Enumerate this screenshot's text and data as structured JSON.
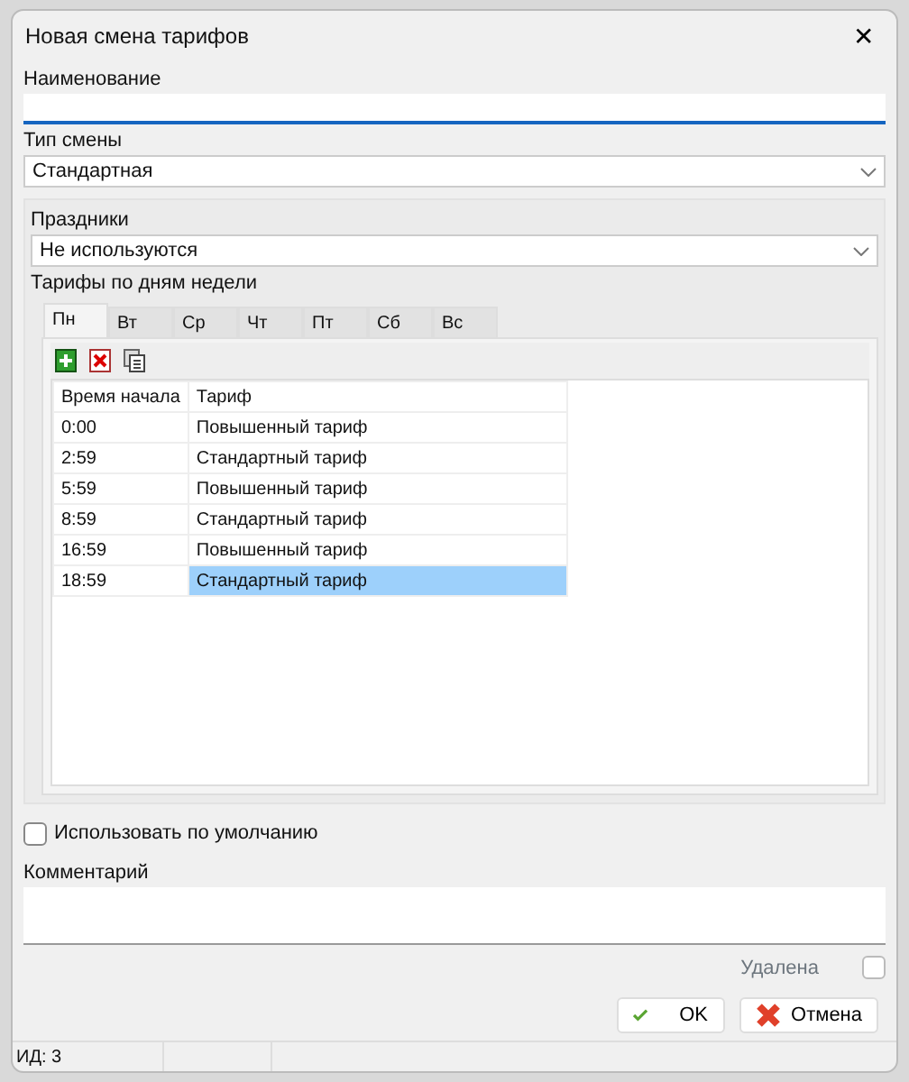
{
  "window": {
    "title": "Новая смена тарифов",
    "close": "✕"
  },
  "name_field": {
    "label": "Наименование"
  },
  "shift_type": {
    "label": "Тип смены",
    "value": "Стандартная"
  },
  "holidays": {
    "label": "Праздники",
    "value": "Не используются"
  },
  "tariffs": {
    "label": "Тарифы по дням недели",
    "tabs": [
      {
        "label": "Пн",
        "selected": true
      },
      {
        "label": "Вт",
        "selected": false
      },
      {
        "label": "Ср",
        "selected": false
      },
      {
        "label": "Чт",
        "selected": false
      },
      {
        "label": "Пт",
        "selected": false
      },
      {
        "label": "Сб",
        "selected": false
      },
      {
        "label": "Вс",
        "selected": false
      }
    ],
    "columns": [
      "Время начала",
      "Тариф"
    ],
    "rows": [
      {
        "start": "0:00",
        "tariff": "Повышенный тариф",
        "selected": false
      },
      {
        "start": "2:59",
        "tariff": "Стандартный тариф",
        "selected": false
      },
      {
        "start": "5:59",
        "tariff": "Повышенный тариф",
        "selected": false
      },
      {
        "start": "8:59",
        "tariff": "Стандартный тариф",
        "selected": false
      },
      {
        "start": "16:59",
        "tariff": "Повышенный тариф",
        "selected": false
      },
      {
        "start": "18:59",
        "tariff": "Стандартный тариф",
        "selected": true
      }
    ]
  },
  "use_default": {
    "label": "Использовать по умолчанию",
    "checked": false
  },
  "comment": {
    "label": "Комментарий"
  },
  "deleted": {
    "label": "Удалена",
    "checked": false
  },
  "buttons": [
    {
      "kind": "ok",
      "label": "OK"
    },
    {
      "kind": "cancel",
      "label": "Отмена"
    }
  ],
  "status_bar": [
    "ИД: 3"
  ]
}
